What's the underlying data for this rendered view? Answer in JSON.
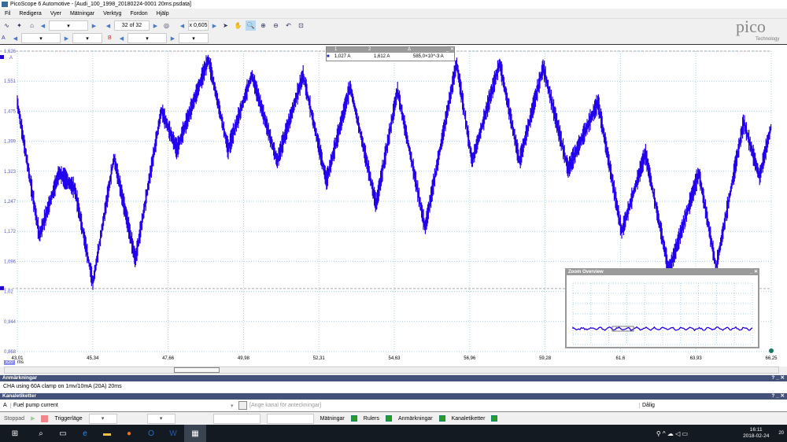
{
  "window": {
    "title": "PicoScope 6 Automotive - [Audi_100_1998_20180224-0001 20ms.psdata]"
  },
  "menu": [
    "Fil",
    "Redigera",
    "Vyer",
    "Mätningar",
    "Verktyg",
    "Fordon",
    "Hjälp"
  ],
  "toolbar": {
    "buffer": "32 of 32",
    "zoom": "x 0,605"
  },
  "channels": {
    "a": "A",
    "b": "B"
  },
  "ruler_table": {
    "headers": [
      "1",
      "2",
      "Δ"
    ],
    "values": [
      "1,027 A",
      "1,612 A",
      "585,0×10^-3 A"
    ]
  },
  "logo": {
    "brand": "pico",
    "sub": "Technology"
  },
  "chart_data": {
    "type": "line",
    "ylabel": "A",
    "xlabel": "ms",
    "xlim": [
      43.01,
      66.25
    ],
    "ylim": [
      0.868,
      1.626
    ],
    "yticks": [
      "1,626",
      "1,551",
      "1,475",
      "1,399",
      "1,323",
      "1,247",
      "1,172",
      "1,096",
      "1,02",
      "0,944",
      "0,868"
    ],
    "xticks": [
      "43,01",
      "45,34",
      "47,66",
      "49,98",
      "52,31",
      "54,63",
      "56,96",
      "59,28",
      "61,6",
      "63,93",
      "66,25"
    ],
    "x_scale_badge": "x20",
    "x_unit": "ms",
    "series": [
      {
        "name": "Fuel pump current",
        "color": "#2200ee",
        "x": [
          43.01,
          43.69,
          44.3,
          44.78,
          45.34,
          45.99,
          46.65,
          47.45,
          47.93,
          48.9,
          49.51,
          50.24,
          51.02,
          51.82,
          52.54,
          53.27,
          54.07,
          54.73,
          55.58,
          56.55,
          57.03,
          57.88,
          58.49,
          59.22,
          59.99,
          60.91,
          61.64,
          62.37,
          63.1,
          64.02,
          64.55,
          65.4,
          65.89,
          66.25
        ],
        "y": [
          1.497,
          1.16,
          1.319,
          1.279,
          1.041,
          1.358,
          1.1,
          1.477,
          1.378,
          1.606,
          1.378,
          1.566,
          1.348,
          1.566,
          1.299,
          1.537,
          1.239,
          1.527,
          1.18,
          1.596,
          1.348,
          1.596,
          1.348,
          1.586,
          1.328,
          1.497,
          1.17,
          1.368,
          1.07,
          1.319,
          1.08,
          1.447,
          1.309,
          1.437
        ]
      }
    ]
  },
  "zoom_overview": {
    "title": "Zoom Overview"
  },
  "notes": {
    "title": "Anmärkningar",
    "text": "CHA using 60A clamp on 1mv/10mA (20A) 20ms"
  },
  "channel_labels": {
    "title": "Kanaletiketter",
    "channel": "A",
    "label": "Fuel pump current",
    "placeholder": "[Ange kanal för anteckningar]",
    "quality": "Dålig"
  },
  "status": {
    "state": "Stoppad",
    "trigger": "Triggerläge",
    "measurements": "Mätningar",
    "rulers": "Rulers",
    "annotations": "Anmärkningar",
    "channel_labels": "Kanaletiketter"
  },
  "taskbar": {
    "time": "16:11",
    "date": "2018-02-24",
    "notifications": "20"
  }
}
